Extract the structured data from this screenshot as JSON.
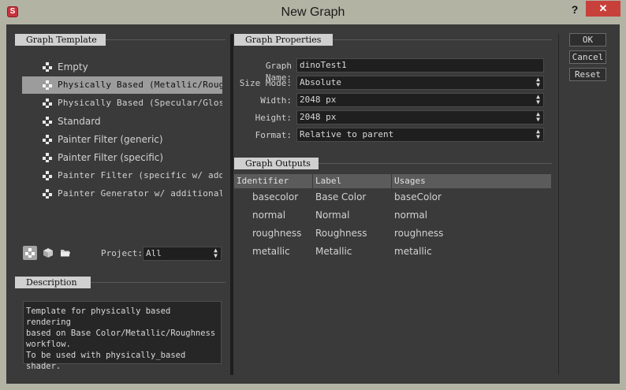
{
  "window": {
    "title": "New Graph",
    "help_glyph": "?",
    "close_glyph": "✕",
    "app_icon_letter": "S"
  },
  "graph_template": {
    "header": "Graph Template",
    "items": [
      {
        "label": "Empty",
        "selected": false
      },
      {
        "label": "Physically Based (Metallic/Rough…",
        "selected": true
      },
      {
        "label": "Physically Based (Specular/Glossi…",
        "selected": false
      },
      {
        "label": "Standard",
        "selected": false
      },
      {
        "label": "Painter Filter (generic)",
        "selected": false
      },
      {
        "label": "Painter Filter (specific)",
        "selected": false
      },
      {
        "label": "Painter Filter (specific w/ additi",
        "selected": false
      },
      {
        "label": "Painter Generator w/ additional …",
        "selected": false
      }
    ],
    "project_label": "Project:",
    "project_value": "All"
  },
  "description": {
    "header": "Description",
    "text": "Template for physically based rendering\nbased on Base Color/Metallic/Roughness\nworkflow.\nTo be used with physically_based shader."
  },
  "graph_properties": {
    "header": "Graph Properties",
    "fields": [
      {
        "label": "Graph Name:",
        "value": "dinoTest1",
        "type": "text"
      },
      {
        "label": "Size Mode:",
        "value": "Absolute",
        "type": "select"
      },
      {
        "label": "Width:",
        "value": "2048 px",
        "type": "select"
      },
      {
        "label": "Height:",
        "value": "2048 px",
        "type": "select"
      },
      {
        "label": "Format:",
        "value": "Relative to parent",
        "type": "select"
      }
    ]
  },
  "graph_outputs": {
    "header": "Graph Outputs",
    "columns": [
      "Identifier",
      "Label",
      "Usages"
    ],
    "rows": [
      [
        "basecolor",
        "Base Color",
        "baseColor"
      ],
      [
        "normal",
        "Normal",
        "normal"
      ],
      [
        "roughness",
        "Roughness",
        "roughness"
      ],
      [
        "metallic",
        "Metallic",
        "metallic"
      ]
    ]
  },
  "buttons": {
    "ok": "OK",
    "cancel": "Cancel",
    "reset": "Reset"
  },
  "colors": {
    "frame": "#b3b3a4",
    "panel": "#3a3a3a",
    "selection": "#9c9c9c",
    "close": "#c7413a"
  }
}
